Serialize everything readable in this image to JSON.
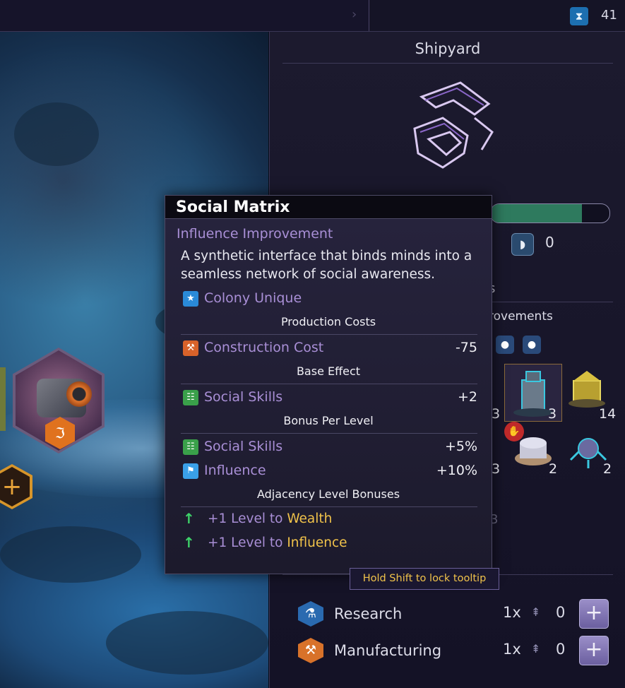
{
  "topbar": {
    "turn_icon": "hourglass-icon",
    "turn_value": "41"
  },
  "space": {
    "hex_badge_icon": "influence-icon",
    "plus_icon": "plus-icon"
  },
  "panel": {
    "title": "Shipyard",
    "progress_fraction": 0.77,
    "shield_value": "0",
    "partial_heading": "s",
    "partial_improvements": "rovements",
    "filter_icons": [
      "person-icon",
      "apple-icon"
    ],
    "buildings": [
      {
        "count": "3"
      },
      {
        "count": "14"
      },
      {
        "count": "2"
      },
      {
        "count": "2"
      }
    ],
    "partial_counts": [
      "3",
      "3",
      "3"
    ],
    "resources": [
      {
        "icon": "flask-icon",
        "label": "Research",
        "multiplier": "1x",
        "count": "0"
      },
      {
        "icon": "hammer-icon",
        "label": "Manufacturing",
        "multiplier": "1x",
        "count": "0"
      }
    ]
  },
  "tooltip": {
    "title": "Social Matrix",
    "category": "Influence Improvement",
    "description": "A synthetic interface that binds minds into a seamless network of social awareness.",
    "unique_label": "Colony Unique",
    "sections": {
      "production": "Production Costs",
      "base": "Base Effect",
      "bonus": "Bonus Per Level",
      "adjacency": "Adjacency Level Bonuses"
    },
    "construction_cost": {
      "label": "Construction Cost",
      "value": "-75"
    },
    "base_effect": {
      "label": "Social Skills",
      "value": "+2"
    },
    "bonus_per_level": [
      {
        "label": "Social Skills",
        "value": "+5%"
      },
      {
        "label": "Influence",
        "value": "+10%"
      }
    ],
    "adjacency": [
      {
        "prefix": "+1 Level to ",
        "target": "Wealth"
      },
      {
        "prefix": "+1 Level to ",
        "target": "Influence"
      }
    ]
  },
  "hint": "Hold Shift to lock tooltip",
  "colors": {
    "accent_purple": "#a98fd6",
    "highlight_gold": "#f0c24a",
    "progress_green": "#2e7a5e",
    "arrow_green": "#3ed46a"
  }
}
